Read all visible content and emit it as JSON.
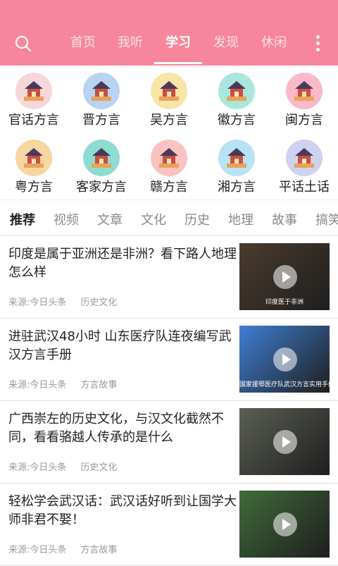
{
  "nav": {
    "tabs": [
      "首页",
      "我听",
      "学习",
      "发现",
      "休闲"
    ],
    "active": "学习"
  },
  "dialects": [
    {
      "label": "官话方言",
      "icon": "temple-of-heaven-icon",
      "color": "#f6d7d9"
    },
    {
      "label": "晋方言",
      "icon": "city-skyline-icon",
      "color": "#b9d3f2"
    },
    {
      "label": "吴方言",
      "icon": "tower-skyline-icon",
      "color": "#f7e5a6"
    },
    {
      "label": "徽方言",
      "icon": "hui-architecture-icon",
      "color": "#a9e7dc"
    },
    {
      "label": "闽方言",
      "icon": "tulou-icon",
      "color": "#f9b9c8"
    },
    {
      "label": "粤方言",
      "icon": "canton-tower-icon",
      "color": "#f8d6a2"
    },
    {
      "label": "客家方言",
      "icon": "hakka-roundhouse-icon",
      "color": "#8edbd1"
    },
    {
      "label": "赣方言",
      "icon": "pavilion-icon",
      "color": "#f8c3c0"
    },
    {
      "label": "湘方言",
      "icon": "yueyang-tower-icon",
      "color": "#b8e3f4"
    },
    {
      "label": "平话土话",
      "icon": "deer-icon",
      "color": "#cfd1f1"
    }
  ],
  "categories": [
    "推荐",
    "视频",
    "文章",
    "文化",
    "历史",
    "地理",
    "故事",
    "搞笑"
  ],
  "active_category": "推荐",
  "articles": [
    {
      "title": "印度是属于亚洲还是非洲？看下路人地理怎么样",
      "source": "来源:今日头条",
      "tag": "历史文化",
      "thumb_caption": "印度医于非洲",
      "thumb_color": "#4a3b2e"
    },
    {
      "title": "进驻武汉48小时 山东医疗队连夜编写武汉方言手册",
      "source": "来源:今日头条",
      "tag": "方言故事",
      "thumb_caption": "国家援鄂医疗队武汉方言实用手册",
      "thumb_color": "#3f7fd4"
    },
    {
      "title": "广西崇左的历史文化，与汉文化截然不同，看看骆越人传承的是什么",
      "source": "来源:今日头条",
      "tag": "历史文化",
      "thumb_caption": "",
      "thumb_color": "#5b5f55"
    },
    {
      "title": "轻松学会武汉话：武汉话好听到让国学大师非君不娶！",
      "source": "来源:今日头条",
      "tag": "方言故事",
      "thumb_caption": "",
      "thumb_color": "#3f6b3a"
    }
  ]
}
